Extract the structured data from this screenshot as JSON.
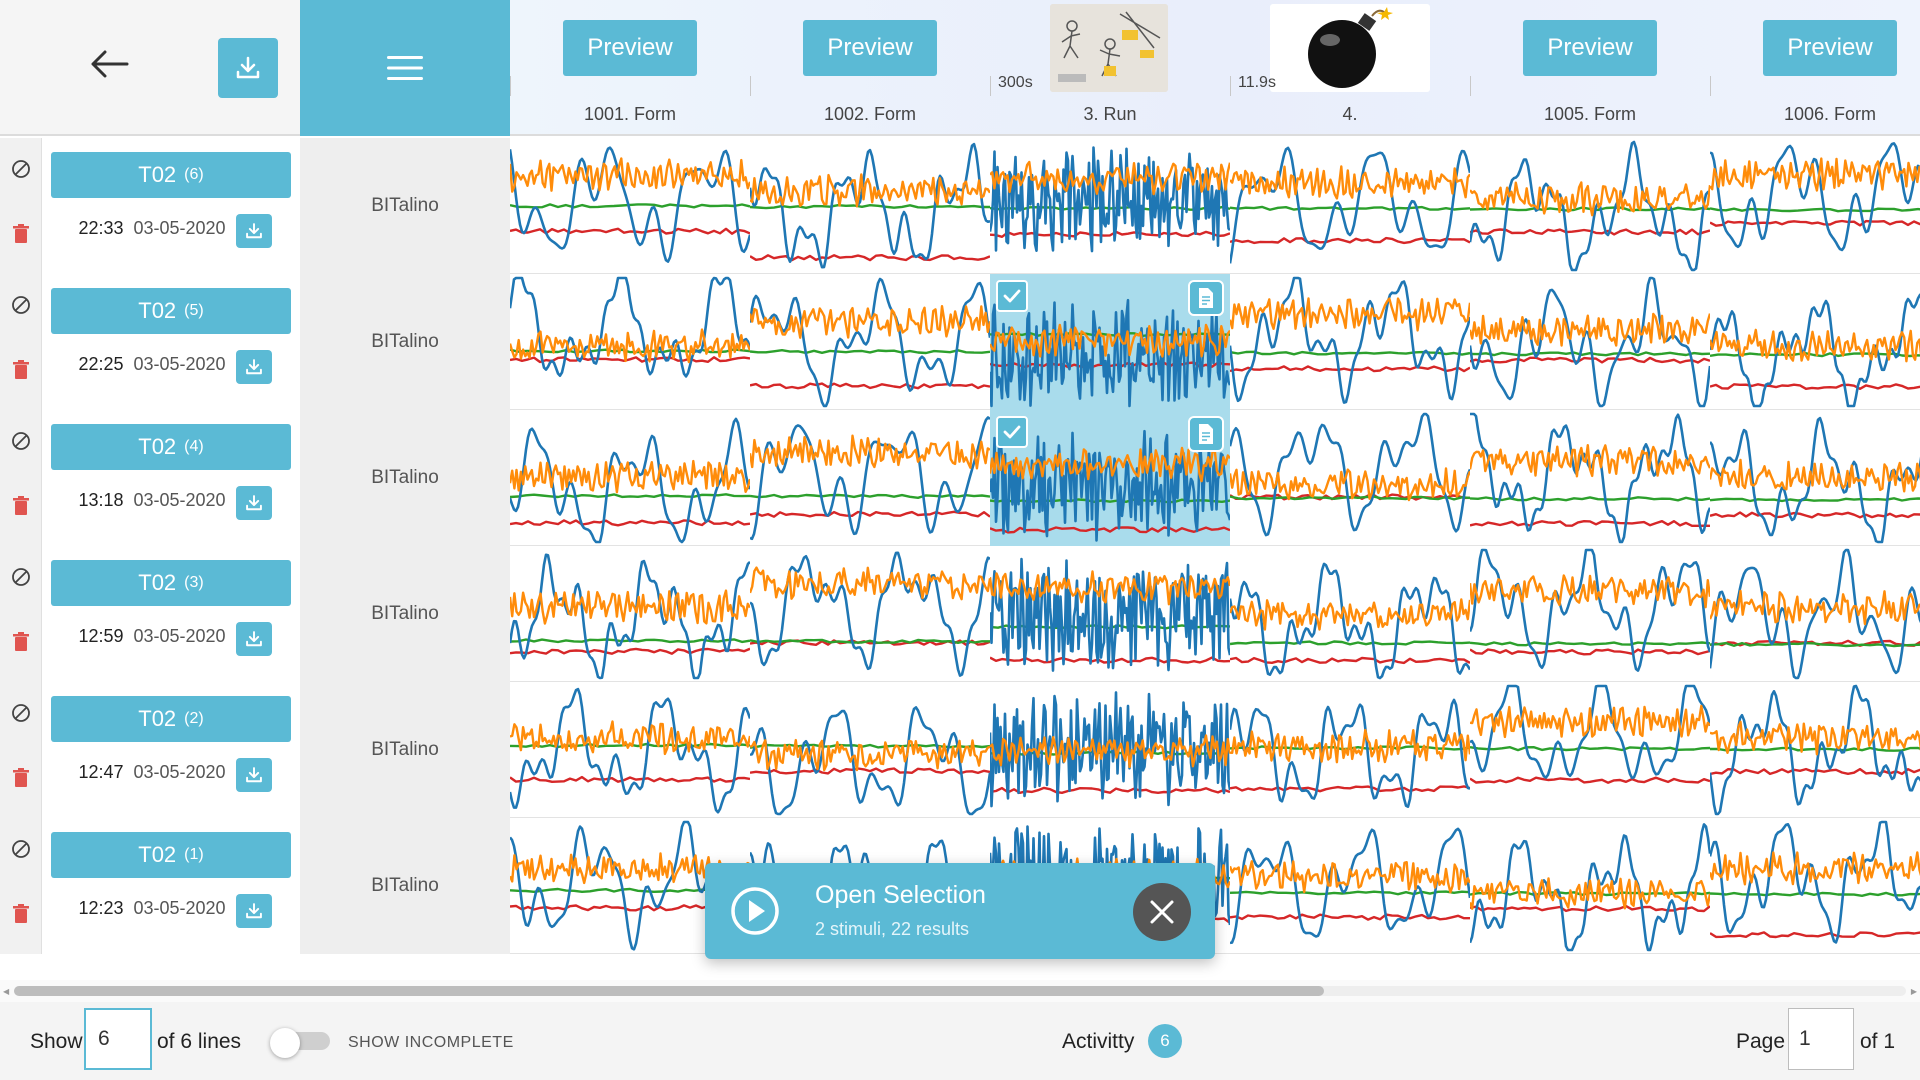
{
  "header": {
    "stimuli": [
      {
        "label": "1001. Form",
        "preview_label": "Preview",
        "type": "preview"
      },
      {
        "label": "1002. Form",
        "preview_label": "Preview",
        "type": "preview"
      },
      {
        "label": "3. Run",
        "duration": "300s",
        "type": "image-run"
      },
      {
        "label": "4.",
        "duration": "11.9s",
        "type": "image-bomb"
      },
      {
        "label": "1005. Form",
        "preview_label": "Preview",
        "type": "preview"
      },
      {
        "label": "1006. Form",
        "preview_label": "Preview",
        "type": "preview"
      }
    ]
  },
  "rows": [
    {
      "name": "T02",
      "count": "(6)",
      "time": "22:33",
      "date": "03-05-2020",
      "device": "BITalino"
    },
    {
      "name": "T02",
      "count": "(5)",
      "time": "22:25",
      "date": "03-05-2020",
      "device": "BITalino"
    },
    {
      "name": "T02",
      "count": "(4)",
      "time": "13:18",
      "date": "03-05-2020",
      "device": "BITalino"
    },
    {
      "name": "T02",
      "count": "(3)",
      "time": "12:59",
      "date": "03-05-2020",
      "device": "BITalino"
    },
    {
      "name": "T02",
      "count": "(2)",
      "time": "12:47",
      "date": "03-05-2020",
      "device": "BITalino"
    },
    {
      "name": "T02",
      "count": "(1)",
      "time": "12:23",
      "date": "03-05-2020",
      "device": "BITalino"
    }
  ],
  "selected_cells": [
    {
      "row": 1,
      "col": 2
    },
    {
      "row": 2,
      "col": 2
    }
  ],
  "signal_colors": {
    "blue": "#1f77b4",
    "orange": "#ff8c0a",
    "green": "#2ca02c",
    "red": "#d62728"
  },
  "accent_color": "#5bbad5",
  "popup": {
    "title": "Open Selection",
    "subtitle": "2 stimuli, 22 results"
  },
  "footer": {
    "show_label": "Show",
    "lines_value": "6",
    "of_lines_label": "of 6 lines",
    "show_incomplete_label": "SHOW INCOMPLETE",
    "show_incomplete_on": false,
    "activity_label": "Activitty",
    "activity_count": "6",
    "page_label": "Page",
    "page_value": "1",
    "page_total_label": "of 1"
  },
  "icons": {
    "back": "arrow-left-icon",
    "download": "download-icon",
    "menu": "hamburger-menu-icon",
    "ban": "ban-icon",
    "trash": "trash-icon",
    "check": "check-icon",
    "document": "document-icon",
    "play": "play-icon",
    "close": "close-icon"
  }
}
